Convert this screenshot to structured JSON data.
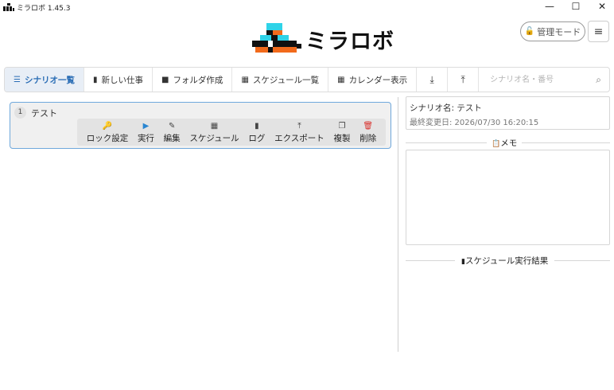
{
  "window": {
    "title": "ミラロボ 1.45.3",
    "min_icon": "—",
    "max_icon": "☐",
    "close_icon": "✕"
  },
  "header": {
    "logo_text": "ミラロボ",
    "admin_label": "管理モード",
    "admin_icon": "🔓",
    "menu_icon": "≡"
  },
  "toolbar": {
    "tabs": [
      {
        "icon": "☰",
        "label": "シナリオ一覧"
      },
      {
        "icon": "▮",
        "label": "新しい仕事"
      },
      {
        "icon": "■",
        "label": "フォルダ作成"
      },
      {
        "icon": "▦",
        "label": "スケジュール一覧"
      },
      {
        "icon": "▦",
        "label": "カレンダー表示"
      }
    ],
    "import_icon": "⤓",
    "export_icon": "⤒",
    "search_placeholder": "シナリオ名・番号",
    "search_value": "",
    "search_icon": "⌕"
  },
  "scenario": {
    "number": "1",
    "title": "テスト",
    "actions": [
      {
        "icon": "🔑",
        "label": "ロック設定"
      },
      {
        "icon": "▶",
        "label": "実行"
      },
      {
        "icon": "✎",
        "label": "編集"
      },
      {
        "icon": "▦",
        "label": "スケジュール"
      },
      {
        "icon": "▮",
        "label": "ログ"
      },
      {
        "icon": "⤒",
        "label": "エクスポート"
      },
      {
        "icon": "❐",
        "label": "複製"
      },
      {
        "icon": "🗑",
        "label": "削除"
      }
    ]
  },
  "detail": {
    "name": "シナリオ名: テスト",
    "modified": "最終変更日: 2026/07/30 16:20:15",
    "memo_label": "メモ",
    "memo_icon": "📋",
    "schedule_label": "スケジュール実行結果",
    "schedule_icon": "▮"
  },
  "colors": {
    "accent": "#2a6db5",
    "logo_cyan": "#2fd3e8",
    "logo_orange": "#f26a1b",
    "delete_red": "#d9302b",
    "play_blue": "#2a86d1"
  }
}
